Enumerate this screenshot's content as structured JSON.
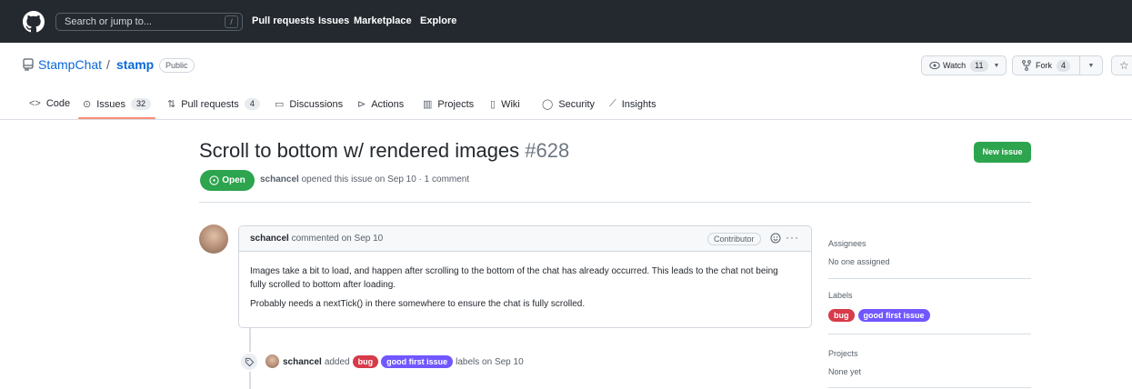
{
  "header": {
    "search_placeholder": "Search or jump to...",
    "search_shortcut": "/",
    "nav": [
      "Pull requests",
      "Issues",
      "Marketplace",
      "Explore"
    ]
  },
  "repo": {
    "owner": "StampChat",
    "separator": "/",
    "name": "stamp",
    "visibility": "Public",
    "watch_label": "Watch",
    "watch_count": "11",
    "fork_label": "Fork",
    "fork_count": "4"
  },
  "tabs": [
    {
      "label": "Code",
      "icon": "code-icon"
    },
    {
      "label": "Issues",
      "count": "32",
      "icon": "issue-opened-icon",
      "selected": true
    },
    {
      "label": "Pull requests",
      "count": "4",
      "icon": "git-pull-request-icon"
    },
    {
      "label": "Discussions",
      "icon": "comment-discussion-icon"
    },
    {
      "label": "Actions",
      "icon": "play-icon"
    },
    {
      "label": "Projects",
      "icon": "table-icon"
    },
    {
      "label": "Wiki",
      "icon": "book-icon"
    },
    {
      "label": "Security",
      "icon": "shield-icon"
    },
    {
      "label": "Insights",
      "icon": "graph-icon"
    }
  ],
  "issue": {
    "title": "Scroll to bottom w/ rendered images",
    "number": "#628",
    "new_issue_label": "New issue",
    "state": "Open",
    "author": "schancel",
    "meta_text": "opened this issue on Sep 10 · 1 comment"
  },
  "comment": {
    "author": "schancel",
    "action": "commented on Sep 10",
    "role": "Contributor",
    "paragraphs": [
      "Images take a bit to load, and happen after scrolling to the bottom of the chat has already occurred. This leads to the chat not being fully scrolled to bottom after loading.",
      "Probably needs a nextTick() in there somewhere to ensure the chat is fully scrolled."
    ]
  },
  "event": {
    "actor": "schancel",
    "verb": "added",
    "suffix": "labels on Sep 10"
  },
  "labels": [
    {
      "name": "bug",
      "color": "#d73a4a"
    },
    {
      "name": "good first issue",
      "color": "#7057ff"
    }
  ],
  "sidebar": {
    "assignees_heading": "Assignees",
    "assignees_value": "No one assigned",
    "labels_heading": "Labels",
    "projects_heading": "Projects",
    "projects_value": "None yet"
  },
  "colors": {
    "header_bg": "#24292f",
    "link": "#0969da",
    "success": "#2da44e",
    "tab_underline": "#fd8c73"
  }
}
